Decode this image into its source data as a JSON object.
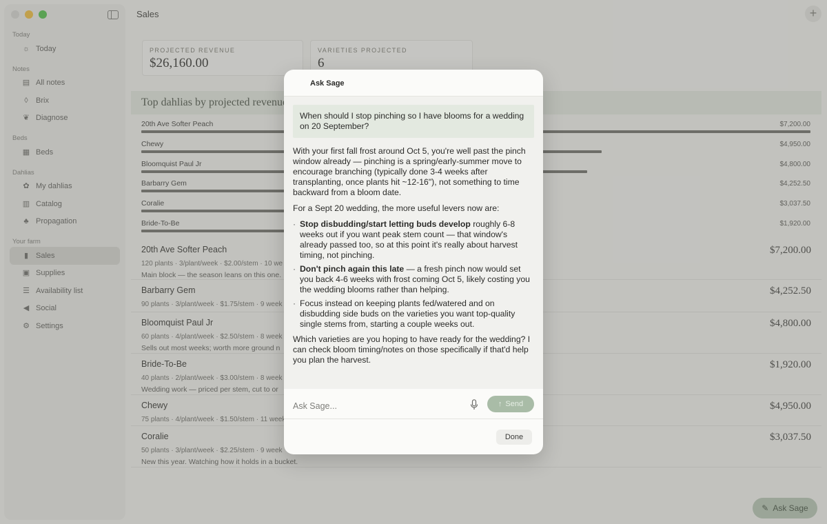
{
  "sidebar": {
    "sections": [
      {
        "label": "Today",
        "items": [
          {
            "label": "Today",
            "icon": "sun-icon"
          }
        ]
      },
      {
        "label": "Notes",
        "items": [
          {
            "label": "All notes",
            "icon": "notes-icon"
          },
          {
            "label": "Brix",
            "icon": "drop-icon"
          },
          {
            "label": "Diagnose",
            "icon": "leaf-icon"
          }
        ]
      },
      {
        "label": "Beds",
        "items": [
          {
            "label": "Beds",
            "icon": "grid-icon"
          }
        ]
      },
      {
        "label": "Dahlias",
        "items": [
          {
            "label": "My dahlias",
            "icon": "flower-icon"
          },
          {
            "label": "Catalog",
            "icon": "book-icon"
          },
          {
            "label": "Propagation",
            "icon": "sprout-icon"
          }
        ]
      },
      {
        "label": "Your farm",
        "items": [
          {
            "label": "Sales",
            "icon": "bar-chart-icon",
            "active": true
          },
          {
            "label": "Supplies",
            "icon": "box-icon"
          },
          {
            "label": "Availability list",
            "icon": "list-icon"
          },
          {
            "label": "Social",
            "icon": "megaphone-icon"
          },
          {
            "label": "Settings",
            "icon": "gear-icon"
          }
        ]
      }
    ]
  },
  "header": {
    "title": "Sales",
    "add_label": "+"
  },
  "stats": [
    {
      "label": "PROJECTED REVENUE",
      "value": "$26,160.00"
    },
    {
      "label": "VARIETIES PROJECTED",
      "value": "6"
    }
  ],
  "chart_data": {
    "type": "bar",
    "title": "Top dahlias by projected revenue",
    "categories": [
      "20th Ave Softer Peach",
      "Chewy",
      "Bloomquist Paul Jr",
      "Barbarry Gem",
      "Coralie",
      "Bride-To-Be"
    ],
    "values": [
      7200.0,
      4950.0,
      4800.0,
      4252.5,
      3037.5,
      1920.0
    ],
    "value_labels": [
      "$7,200.00",
      "$4,950.00",
      "$4,800.00",
      "$4,252.50",
      "$3,037.50",
      "$1,920.00"
    ],
    "xlim": [
      0,
      7200
    ]
  },
  "list": [
    {
      "name": "20th Ave Softer Peach",
      "meta": "120 plants · 3/plant/week · $2.00/stem · 10 we",
      "note": "Main block — the season leans on this one.",
      "price": "$7,200.00"
    },
    {
      "name": "Barbarry Gem",
      "meta": "90 plants · 3/plant/week · $1.75/stem · 9 week",
      "note": "",
      "price": "$4,252.50"
    },
    {
      "name": "Bloomquist Paul Jr",
      "meta": "60 plants · 4/plant/week · $2.50/stem · 8 week",
      "note": "Sells out most weeks; worth more ground n",
      "price": "$4,800.00"
    },
    {
      "name": "Bride-To-Be",
      "meta": "40 plants · 2/plant/week · $3.00/stem · 8 week",
      "note": "Wedding work — priced per stem, cut to or",
      "price": "$1,920.00"
    },
    {
      "name": "Chewy",
      "meta": "75 plants · 4/plant/week · $1.50/stem · 11 week",
      "note": "",
      "price": "$4,950.00"
    },
    {
      "name": "Coralie",
      "meta": "50 plants · 3/plant/week · $2.25/stem · 9 week",
      "note": "New this year. Watching how it holds in a bucket.",
      "price": "$3,037.50"
    }
  ],
  "fab": {
    "label": "Ask Sage"
  },
  "modal": {
    "title": "Ask Sage",
    "question": "When should I stop pinching so I have blooms for a wedding on 20 September?",
    "reply": {
      "p1": "With your first fall frost around Oct 5, you're well past the pinch window already — pinching is a spring/early-summer move to encourage branching (typically done 3-4 weeks after transplanting, once plants hit ~12-16\"), not something to time backward from a bloom date.",
      "p2": "For a Sept 20 wedding, the more useful levers now are:",
      "b1_bold": "Stop disbudding/start letting buds develop",
      "b1_rest": " roughly 6-8 weeks out if you want peak stem count — that window's already passed too, so at this point it's really about harvest timing, not pinching.",
      "b2_bold": "Don't pinch again this late",
      "b2_rest": " — a fresh pinch now would set you back 4-6 weeks with frost coming Oct 5, likely costing you the wedding blooms rather than helping.",
      "b3": "Focus instead on keeping plants fed/watered and on disbudding side buds on the varieties you want top-quality single stems from, starting a couple weeks out.",
      "p3": "Which varieties are you hoping to have ready for the wedding? I can check bloom timing/notes on those specifically if that'd help you plan the harvest."
    },
    "input_placeholder": "Ask Sage...",
    "send_label": "Send",
    "done_label": "Done"
  }
}
